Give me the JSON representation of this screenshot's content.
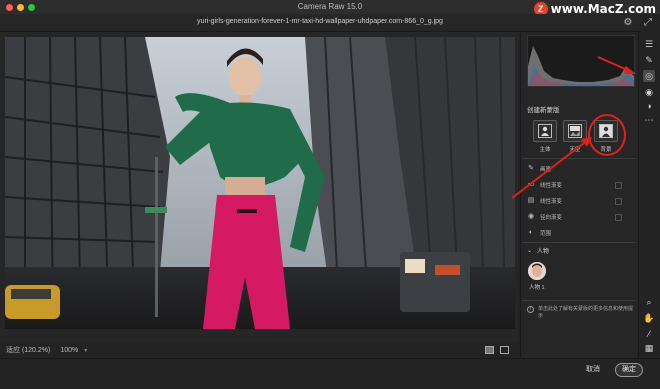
{
  "app": {
    "title": "Camera Raw 15.0"
  },
  "watermark": {
    "logo_letter": "Z",
    "text": "www.MacZ.com"
  },
  "file": {
    "name": "yuri-girls-generation-forever-1-mr-taxi-hd-wallpaper-uhdpaper.com-866_0_g.jpg"
  },
  "zoom": {
    "fit_label": "适应 (120.2%)",
    "level": "100%"
  },
  "mask_panel": {
    "title": "创建新蒙版",
    "buttons": [
      {
        "label": "主体",
        "icon": "subject-icon"
      },
      {
        "label": "天空",
        "icon": "sky-icon"
      },
      {
        "label": "背景",
        "icon": "background-icon"
      }
    ],
    "tools": [
      {
        "label": "画笔",
        "icon": "brush-icon"
      },
      {
        "label": "线性渐变",
        "icon": "linear-gradient-icon"
      },
      {
        "label": "线性渐变",
        "icon": "linear-gradient-icon"
      },
      {
        "label": "径向渐变",
        "icon": "radial-gradient-icon"
      },
      {
        "label": "范围",
        "icon": "range-icon"
      }
    ]
  },
  "people": {
    "header": "人物",
    "items": [
      {
        "label": "人物 1"
      }
    ],
    "note": "单击此处了解有关蒙版的更多信息和使用提示"
  },
  "footer": {
    "cancel": "取消",
    "ok": "确定"
  },
  "colors": {
    "annotation": "#e0211b",
    "accent_red": "#e0442c",
    "dress_green": "#1f6b4a",
    "skirt_pink": "#d51a63"
  }
}
